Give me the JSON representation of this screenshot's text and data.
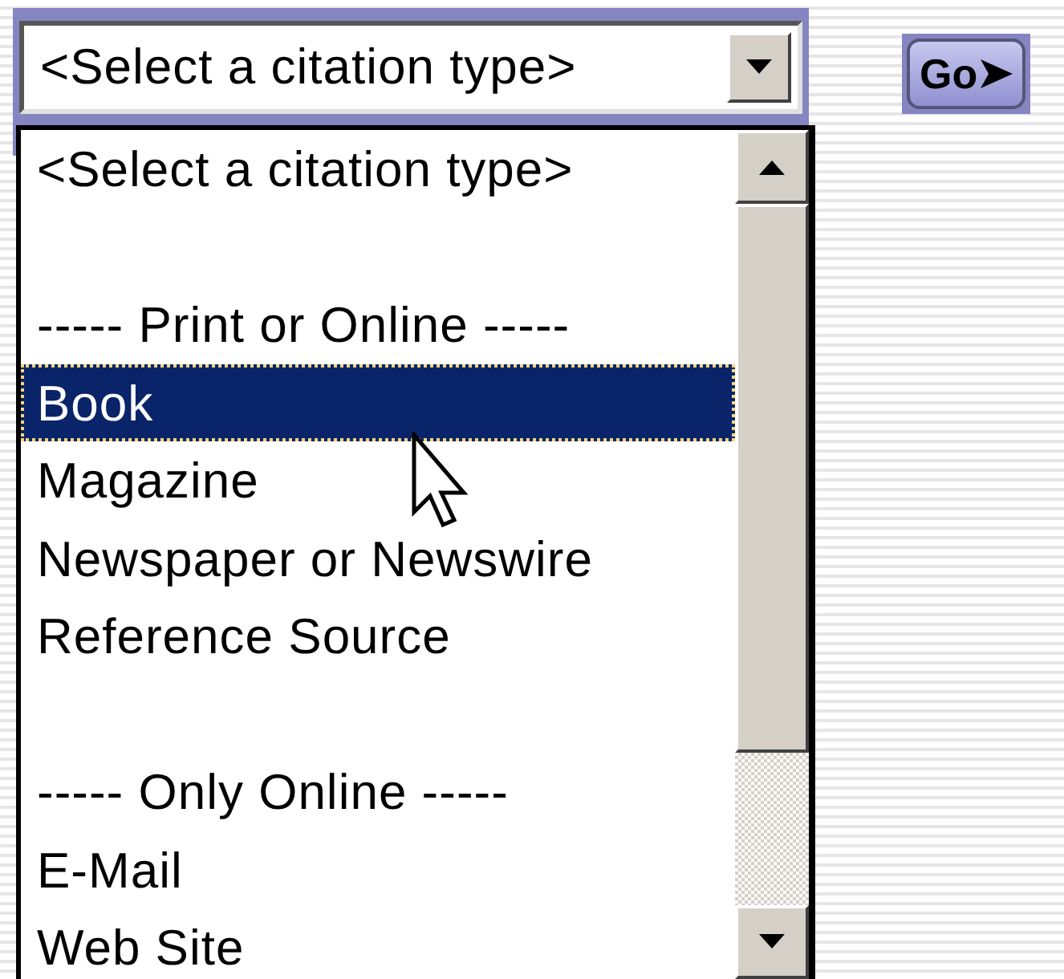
{
  "select": {
    "value": "<Select a citation type>",
    "open": true
  },
  "go_button": {
    "label": "Go"
  },
  "options": [
    {
      "kind": "option",
      "label": "<Select a citation type>",
      "selected": false
    },
    {
      "kind": "blank"
    },
    {
      "kind": "option",
      "label": "----- Print or Online -----",
      "selected": false
    },
    {
      "kind": "option",
      "label": "Book",
      "selected": true
    },
    {
      "kind": "option",
      "label": "Magazine",
      "selected": false
    },
    {
      "kind": "option",
      "label": "Newspaper or Newswire",
      "selected": false
    },
    {
      "kind": "option",
      "label": "Reference Source",
      "selected": false
    },
    {
      "kind": "blank"
    },
    {
      "kind": "option",
      "label": "----- Only Online -----",
      "selected": false
    },
    {
      "kind": "option",
      "label": "E-Mail",
      "selected": false
    },
    {
      "kind": "option",
      "label": "Web Site",
      "selected": false
    }
  ]
}
